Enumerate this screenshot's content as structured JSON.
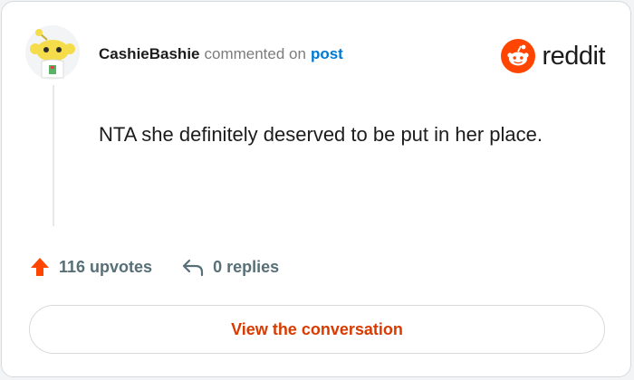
{
  "comment": {
    "username": "CashieBashie",
    "action_text": "commented on",
    "post_link": "post",
    "body": "NTA she definitely deserved to be put in her place."
  },
  "brand": {
    "wordmark": "reddit",
    "color": "#ff4500"
  },
  "stats": {
    "upvotes_label": "116 upvotes",
    "replies_label": "0 replies",
    "upvote_icon": "upvote-arrow-icon",
    "reply_icon": "reply-arrow-icon"
  },
  "cta": {
    "label": "View the conversation",
    "color": "#d93a00"
  },
  "colors": {
    "username": "#1c1c1c",
    "muted": "#7c7c7c",
    "link": "#0079d3",
    "upvote": "#ff4500"
  }
}
